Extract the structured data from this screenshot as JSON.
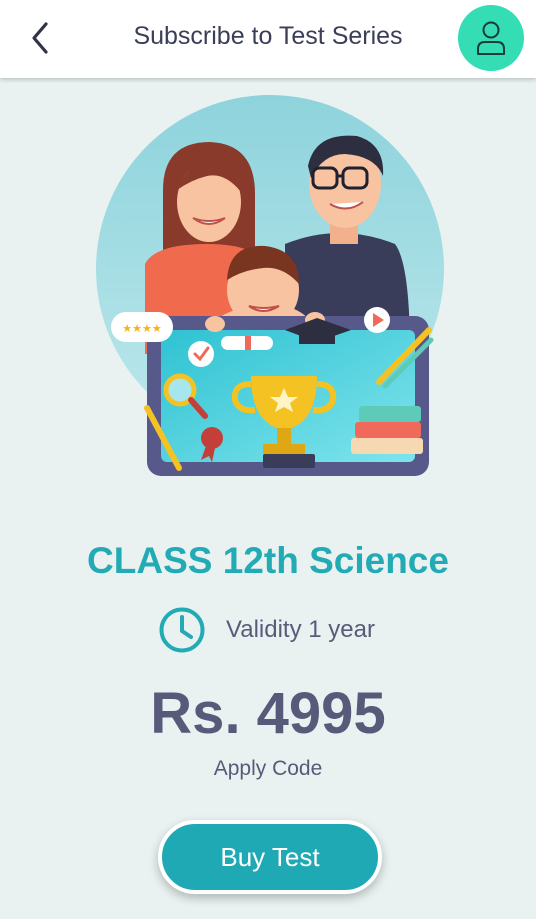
{
  "header": {
    "title": "Subscribe to Test Series"
  },
  "icons": {
    "back": "chevron-left-icon",
    "profile": "user-icon",
    "clock": "clock-icon"
  },
  "colors": {
    "accent": "#22abb5",
    "avatar_bg": "#34ddb4",
    "button_bg": "#1fa9b5",
    "text_dark": "#585a7a",
    "background": "#e9f2f1"
  },
  "course": {
    "title": "CLASS 12th Science",
    "validity": "Validity 1 year",
    "price": "Rs. 4995",
    "apply_code": "Apply Code"
  },
  "actions": {
    "buy_label": "Buy Test"
  }
}
